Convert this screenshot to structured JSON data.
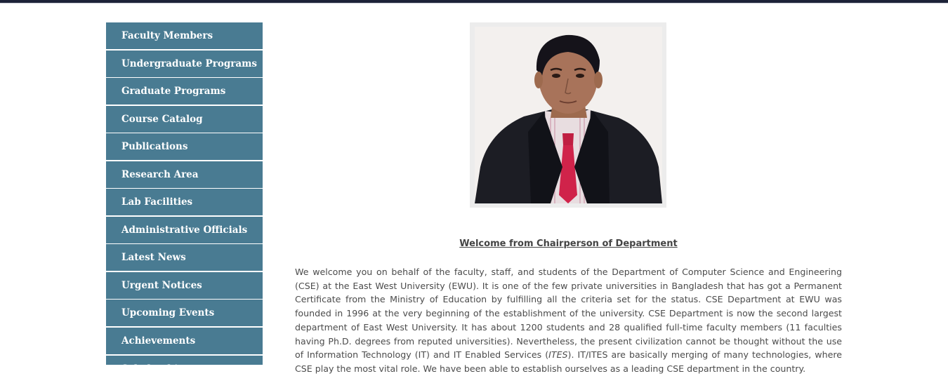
{
  "sidebar": {
    "items": [
      {
        "label": "Faculty Members"
      },
      {
        "label": "Undergraduate Programs"
      },
      {
        "label": "Graduate Programs"
      },
      {
        "label": "Course Catalog"
      },
      {
        "label": "Publications"
      },
      {
        "label": "Research Area"
      },
      {
        "label": "Lab Facilities"
      },
      {
        "label": "Administrative Officials"
      },
      {
        "label": "Latest News"
      },
      {
        "label": "Urgent Notices"
      },
      {
        "label": "Upcoming Events"
      },
      {
        "label": "Achievements"
      },
      {
        "label": "Scholarship"
      }
    ]
  },
  "main": {
    "welcome_title": "Welcome from Chairperson of Department",
    "welcome_text_1": "We welcome you on behalf of the faculty, staff, and students of the Department of Computer Science and Engineering (CSE) at the East West University (EWU). It is one of the few private universities in Bangladesh that has got a Permanent Certificate from the Ministry of Education by fulfilling all the criteria set for the status. CSE Department at EWU was founded in 1996 at the very beginning of the establishment of the university. CSE Department is now the second largest department of East West University. It has about 1200 students and 28 qualified full-time faculty members (11 faculties having Ph.D. degrees from reputed universities). Nevertheless, the present civilization cannot be thought without the use of Information Technology (IT) and IT Enabled Services (",
    "welcome_text_ites": "ITES",
    "welcome_text_2": "). IT/ITES are basically merging of many technologies, where CSE play the most vital role. We have been able to establish ourselves as a leading CSE department in the country."
  },
  "colors": {
    "sidebar_bg": "#497b92",
    "sidebar_text": "#ffffff",
    "body_text": "#4b4b4b",
    "top_bar": "#1d2338"
  }
}
